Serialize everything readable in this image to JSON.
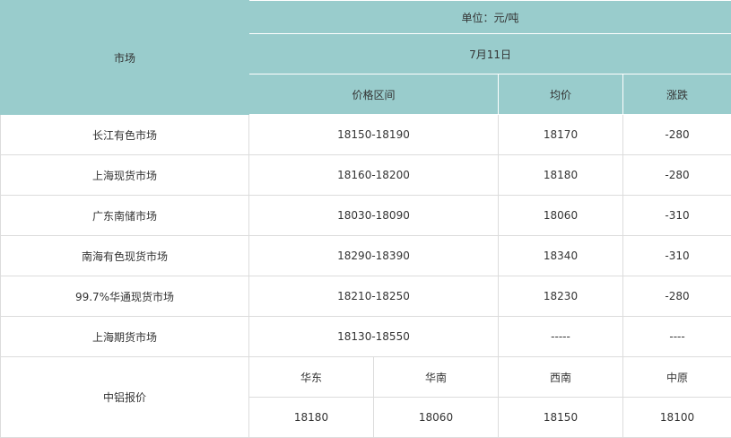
{
  "header": {
    "market_label": "市场",
    "unit": "单位：元/吨",
    "date": "7月11日",
    "col_range": "价格区间",
    "col_avg": "均价",
    "col_change": "涨跌"
  },
  "rows": [
    {
      "market": "长江有色市场",
      "range": "18150-18190",
      "avg": "18170",
      "change": "-280"
    },
    {
      "market": "上海现货市场",
      "range": "18160-18200",
      "avg": "18180",
      "change": "-280"
    },
    {
      "market": "广东南储市场",
      "range": "18030-18090",
      "avg": "18060",
      "change": "-310"
    },
    {
      "market": "南海有色现货市场",
      "range": "18290-18390",
      "avg": "18340",
      "change": "-310"
    },
    {
      "market": "99.7%华通现货市场",
      "range": "18210-18250",
      "avg": "18230",
      "change": "-280"
    },
    {
      "market": "上海期货市场",
      "range": "18130-18550",
      "avg": "-----",
      "change": "----"
    }
  ],
  "quote": {
    "label": "中铝报价",
    "regions": [
      "华东",
      "华南",
      "西南",
      "中原"
    ],
    "values": [
      "18180",
      "18060",
      "18150",
      "18100"
    ]
  },
  "colors": {
    "header_bg": "#99cccc",
    "border": "#dcdcdc"
  }
}
